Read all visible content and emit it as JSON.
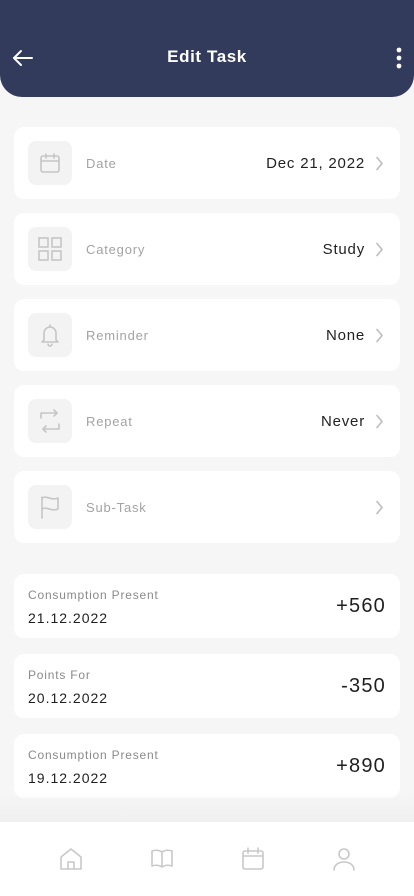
{
  "header": {
    "title": "Edit Task",
    "back_icon": "arrow-left-icon",
    "more_icon": "more-vertical-icon",
    "background_color": "#323b5c"
  },
  "fields": [
    {
      "label": "Date",
      "value": "Dec 21, 2022",
      "icon": "calendar-icon"
    },
    {
      "label": "Category",
      "value": "Study",
      "icon": "grid-icon"
    },
    {
      "label": "Reminder",
      "value": "None",
      "icon": "bell-icon"
    },
    {
      "label": "Repeat",
      "value": "Never",
      "icon": "repeat-icon"
    },
    {
      "label": "Sub-Task",
      "value": "",
      "icon": "flag-icon"
    }
  ],
  "transactions": [
    {
      "label": "Consumption Present",
      "date": "21.12.2022",
      "amount": "+560"
    },
    {
      "label": "Points For",
      "date": "20.12.2022",
      "amount": "-350"
    },
    {
      "label": "Consumption Present",
      "date": "19.12.2022",
      "amount": "+890"
    }
  ],
  "tabbar": {
    "items": [
      "home-icon",
      "book-icon",
      "calendar-icon",
      "profile-icon"
    ]
  }
}
